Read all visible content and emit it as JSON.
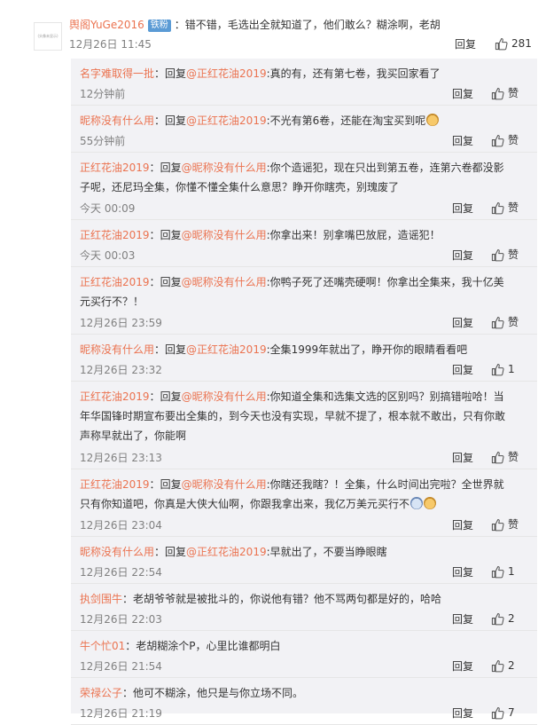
{
  "main_comment": {
    "avatar_text": "(头像未显示)",
    "username": "舆阁YuGe2016",
    "badge": "铁粉",
    "text": "：错不错，毛选出全就知道了，他们敢么？糊涂啊，老胡",
    "time": "12月26日 11:45",
    "reply_label": "回复",
    "likes": "281"
  },
  "replies": [
    {
      "user": "名字难取得一批",
      "sep": "：",
      "prefix": "回复",
      "target": "@正红花油2019",
      "text": ":真的有，还有第七卷，我买回家看了",
      "emoji": "",
      "time": "12分钟前",
      "reply_label": "回复",
      "likes": "赞"
    },
    {
      "user": "昵称没有什么用",
      "sep": "：",
      "prefix": "回复",
      "target": "@正红花油2019",
      "text": ":不光有第6卷，还能在淘宝买到呢",
      "emoji": "dog-emoji",
      "time": "55分钟前",
      "reply_label": "回复",
      "likes": "赞"
    },
    {
      "user": "正红花油2019",
      "sep": "：",
      "prefix": "回复",
      "target": "@昵称没有什么用",
      "text": ":你个造谣犯，现在只出到第五卷，连第六卷都没影子呢，还尼玛全集，你懂不懂全集什么意思？睁开你瞎壳，别瑰废了",
      "emoji": "",
      "time": "今天 00:09",
      "reply_label": "回复",
      "likes": "赞"
    },
    {
      "user": "正红花油2019",
      "sep": "：",
      "prefix": "回复",
      "target": "@昵称没有什么用",
      "text": ":你拿出来！别拿嘴巴放屁，造谣犯！",
      "emoji": "",
      "time": "今天 00:03",
      "reply_label": "回复",
      "likes": "赞"
    },
    {
      "user": "正红花油2019",
      "sep": "：",
      "prefix": "回复",
      "target": "@昵称没有什么用",
      "text": ":你鸭子死了还嘴壳硬啊！你拿出全集来，我十亿美元买行不？！",
      "emoji": "",
      "time": "12月26日 23:59",
      "reply_label": "回复",
      "likes": "赞"
    },
    {
      "user": "昵称没有什么用",
      "sep": "：",
      "prefix": "回复",
      "target": "@正红花油2019",
      "text": ":全集1999年就出了，睁开你的眼睛看看吧",
      "emoji": "",
      "time": "12月26日 23:32",
      "reply_label": "回复",
      "likes": "1"
    },
    {
      "user": "正红花油2019",
      "sep": "：",
      "prefix": "回复",
      "target": "@昵称没有什么用",
      "text": ":你知道全集和选集文选的区别吗？别搞错啦哈！当年华国锋时期宣布要出全集的，到今天也没有实现，早就不提了，根本就不敢出，只有你敢声称早就出了，你能啊",
      "emoji": "",
      "time": "12月26日 23:13",
      "reply_label": "回复",
      "likes": "赞"
    },
    {
      "user": "正红花油2019",
      "sep": "：",
      "prefix": "回复",
      "target": "@昵称没有什么用",
      "text": ":你瞎还我瞎？！全集，什么时间出完啦？全世界就只有你知道吧，你真是大侠大仙啊，你跟我拿出来，我亿万美元买行不",
      "emoji": "cry-dog-emoji",
      "time": "12月26日 23:04",
      "reply_label": "回复",
      "likes": "赞"
    },
    {
      "user": "昵称没有什么用",
      "sep": "：",
      "prefix": "回复",
      "target": "@正红花油2019",
      "text": ":早就出了，不要当睁眼瞎",
      "emoji": "",
      "time": "12月26日 22:54",
      "reply_label": "回复",
      "likes": "1"
    },
    {
      "user": "执剑围牛",
      "sep": "：",
      "prefix": "",
      "target": "",
      "text": "老胡爷爷就是被批斗的，你说他有错？他不骂两句都是好的，哈哈",
      "emoji": "",
      "time": "12月26日 22:03",
      "reply_label": "回复",
      "likes": "2"
    },
    {
      "user": "牛个忙01",
      "sep": "：",
      "prefix": "",
      "target": "",
      "text": "老胡糊涂个P，心里比谁都明白",
      "emoji": "",
      "time": "12月26日 21:54",
      "reply_label": "回复",
      "likes": "2"
    },
    {
      "user": "荣禄公子",
      "sep": "：",
      "prefix": "",
      "target": "",
      "text": "他可不糊涂，他只是与你立场不同。",
      "emoji": "",
      "time": "12月26日 21:19",
      "reply_label": "回复",
      "likes": "7"
    }
  ]
}
